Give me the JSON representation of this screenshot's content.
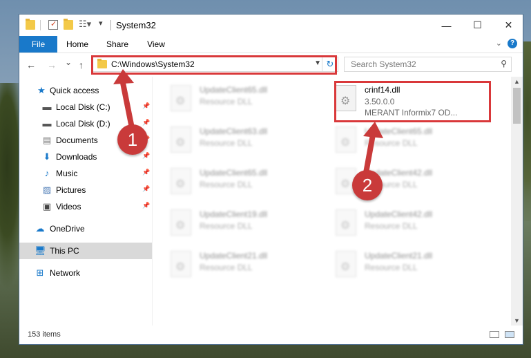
{
  "window": {
    "title": "System32",
    "controls": {
      "minimize": "—",
      "maximize": "☐",
      "close": "✕"
    }
  },
  "ribbon": {
    "tabs": [
      "File",
      "Home",
      "Share",
      "View"
    ],
    "help": "?"
  },
  "nav": {
    "back": "←",
    "forward": "→",
    "recent": "⌄",
    "up": "↑",
    "address": "C:\\Windows\\System32",
    "search_placeholder": "Search System32"
  },
  "sidebar": {
    "items": [
      {
        "label": "Quick access",
        "icon": "star-icon"
      },
      {
        "label": "Local Disk (C:)",
        "icon": "drive-icon",
        "pinned": true
      },
      {
        "label": "Local Disk (D:)",
        "icon": "drive-icon",
        "pinned": true
      },
      {
        "label": "Documents",
        "icon": "documents-icon",
        "pinned": true
      },
      {
        "label": "Downloads",
        "icon": "download-icon",
        "pinned": true
      },
      {
        "label": "Music",
        "icon": "music-icon",
        "pinned": true
      },
      {
        "label": "Pictures",
        "icon": "pictures-icon",
        "pinned": true
      },
      {
        "label": "Videos",
        "icon": "videos-icon",
        "pinned": true
      },
      {
        "label": "OneDrive",
        "icon": "cloud-icon"
      },
      {
        "label": "This PC",
        "icon": "computer-icon",
        "selected": true
      },
      {
        "label": "Network",
        "icon": "network-icon"
      }
    ]
  },
  "files": {
    "highlight": {
      "name": "crinf14.dll",
      "version": "3.50.0.0",
      "description": "MERANT Informix7 OD..."
    },
    "blurred": [
      {
        "name": "UpdateClient65.dll",
        "type": "Resource DLL"
      },
      {
        "name": "UpdateClient63.dll",
        "type": "Resource DLL"
      },
      {
        "name": "UpdateClient65.dll",
        "type": "Resource DLL"
      },
      {
        "name": "UpdateClient65.dll",
        "type": "Resource DLL"
      },
      {
        "name": "UpdateClient42.dll",
        "type": "Resource DLL"
      },
      {
        "name": "UpdateClient19.dll",
        "type": "Resource DLL"
      },
      {
        "name": "UpdateClient42.dll",
        "type": "Resource DLL"
      },
      {
        "name": "UpdateClient21.dll",
        "type": "Resource DLL"
      },
      {
        "name": "UpdateClient21.dll",
        "type": "Resource DLL"
      }
    ]
  },
  "status": {
    "count": "153 items"
  },
  "callouts": {
    "one": "1",
    "two": "2"
  },
  "colors": {
    "accent": "#1979ca",
    "callout": "#c93a3a",
    "highlight_box": "#d9383a"
  }
}
